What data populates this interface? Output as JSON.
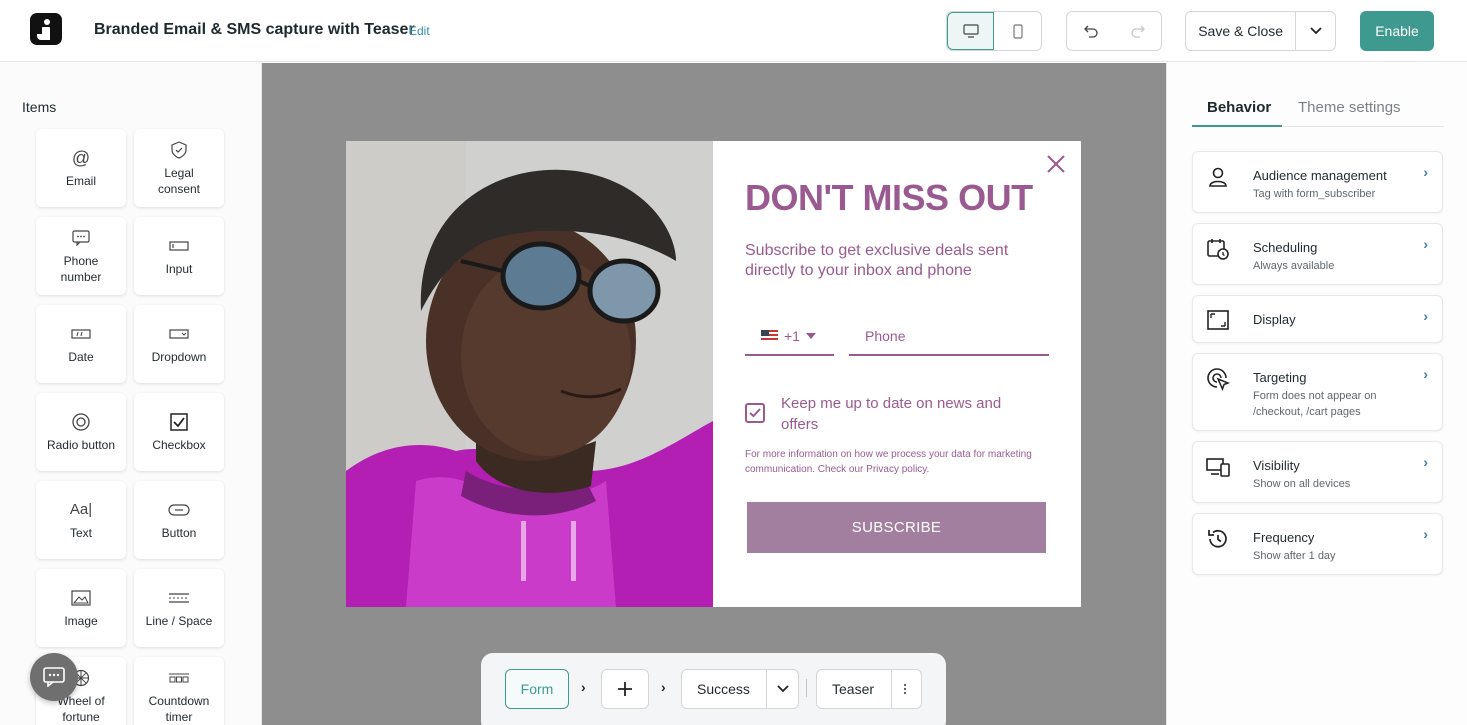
{
  "header": {
    "title": "Branded Email & SMS capture with Teaser",
    "edit_label": "Edit",
    "save_label": "Save & Close",
    "enable_label": "Enable"
  },
  "items_panel": {
    "title": "Items",
    "items": [
      {
        "label": "Email",
        "icon": "at-icon"
      },
      {
        "label": "Legal consent",
        "icon": "shield-check-icon"
      },
      {
        "label": "Phone number",
        "icon": "phone-chat-icon"
      },
      {
        "label": "Input",
        "icon": "input-icon"
      },
      {
        "label": "Date",
        "icon": "date-icon"
      },
      {
        "label": "Dropdown",
        "icon": "dropdown-icon"
      },
      {
        "label": "Radio button",
        "icon": "radio-icon"
      },
      {
        "label": "Checkbox",
        "icon": "checkbox-icon"
      },
      {
        "label": "Text",
        "icon": "text-icon"
      },
      {
        "label": "Button",
        "icon": "button-icon"
      },
      {
        "label": "Image",
        "icon": "image-icon"
      },
      {
        "label": "Line / Space",
        "icon": "line-space-icon"
      },
      {
        "label": "Wheel of fortune",
        "icon": "wheel-icon"
      },
      {
        "label": "Countdown timer",
        "icon": "countdown-icon"
      }
    ],
    "text_glyph": "Aa|"
  },
  "popup": {
    "headline": "DON'T MISS OUT",
    "subline": "Subscribe to get exclusive deals sent directly to your inbox and phone",
    "country_code": "+1",
    "phone_placeholder": "Phone",
    "consent_text": "Keep me up to date on news and offers",
    "consent_checked": true,
    "privacy_text": "For more information on how we process your data for marketing communication. Check our Privacy policy.",
    "subscribe_label": "SUBSCRIBE",
    "accent_color": "#9a5a91",
    "button_color": "#a27f9e"
  },
  "flow": {
    "form_label": "Form",
    "success_label": "Success",
    "teaser_label": "Teaser"
  },
  "right_panel": {
    "tabs": [
      "Behavior",
      "Theme settings"
    ],
    "cards": [
      {
        "name": "Audience management",
        "desc": "Tag with form_subscriber",
        "icon": "person-icon"
      },
      {
        "name": "Scheduling",
        "desc": "Always available",
        "icon": "calendar-clock-icon"
      },
      {
        "name": "Display",
        "desc": "",
        "icon": "display-frame-icon"
      },
      {
        "name": "Targeting",
        "desc": "Form does not appear on /checkout, /cart pages",
        "icon": "target-cursor-icon"
      },
      {
        "name": "Visibility",
        "desc": "Show on all devices",
        "icon": "devices-icon"
      },
      {
        "name": "Frequency",
        "desc": "Show after 1 day",
        "icon": "history-icon"
      }
    ]
  },
  "colors": {
    "primary": "#3e9a8f",
    "canvas": "#8e8e8e"
  }
}
